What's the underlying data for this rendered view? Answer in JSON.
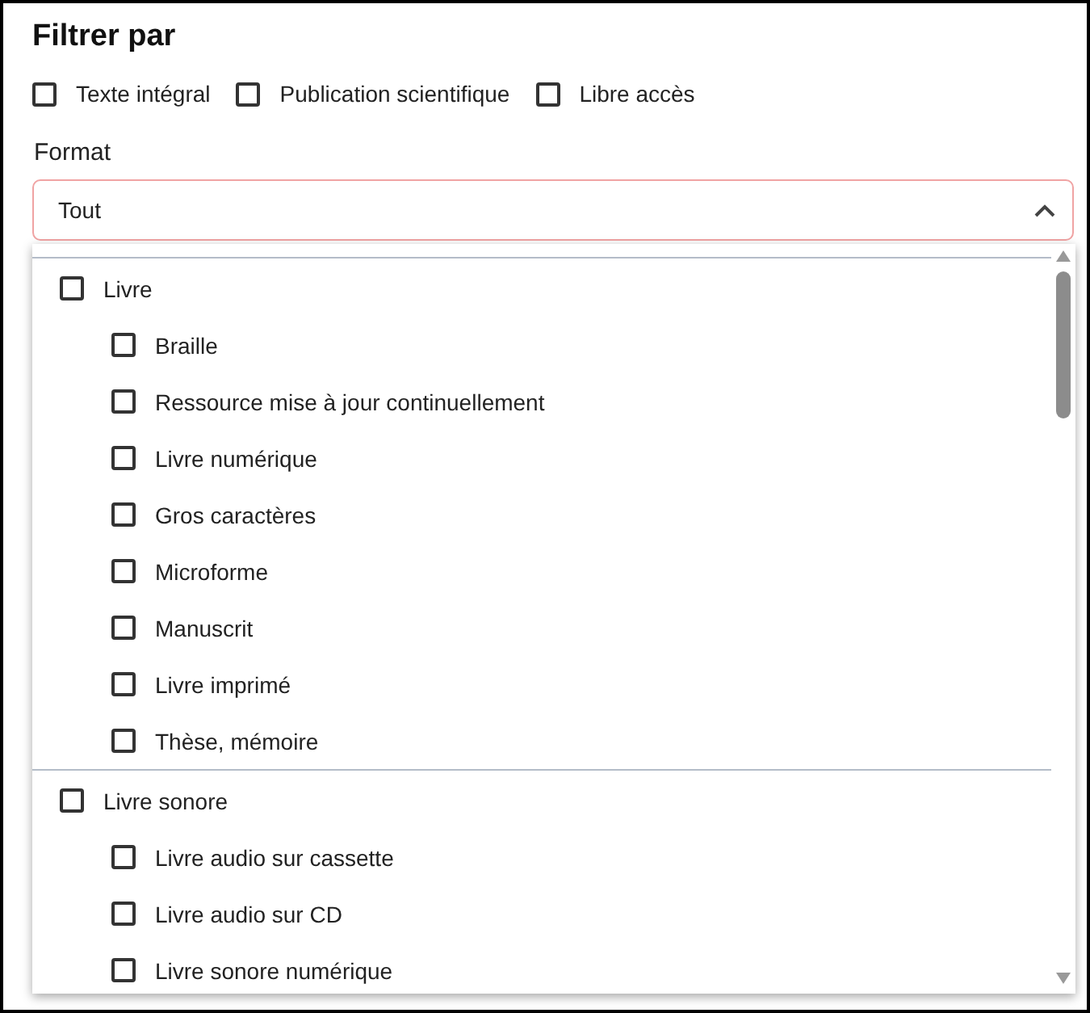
{
  "title": "Filtrer par",
  "filters": [
    {
      "label": "Texte intégral",
      "checked": false
    },
    {
      "label": "Publication scientifique",
      "checked": false
    },
    {
      "label": "Libre accès",
      "checked": false
    }
  ],
  "format": {
    "label": "Format",
    "value": "Tout",
    "expanded": true
  },
  "groups": [
    {
      "label": "Livre",
      "checked": false,
      "children": [
        {
          "label": "Braille",
          "checked": false
        },
        {
          "label": "Ressource mise à jour continuellement",
          "checked": false
        },
        {
          "label": "Livre numérique",
          "checked": false
        },
        {
          "label": "Gros caractères",
          "checked": false
        },
        {
          "label": "Microforme",
          "checked": false
        },
        {
          "label": "Manuscrit",
          "checked": false
        },
        {
          "label": "Livre imprimé",
          "checked": false
        },
        {
          "label": "Thèse, mémoire",
          "checked": false
        }
      ]
    },
    {
      "label": "Livre sonore",
      "checked": false,
      "children": [
        {
          "label": "Livre audio sur cassette",
          "checked": false
        },
        {
          "label": "Livre audio sur CD",
          "checked": false
        },
        {
          "label": "Livre sonore numérique",
          "checked": false
        }
      ]
    }
  ]
}
